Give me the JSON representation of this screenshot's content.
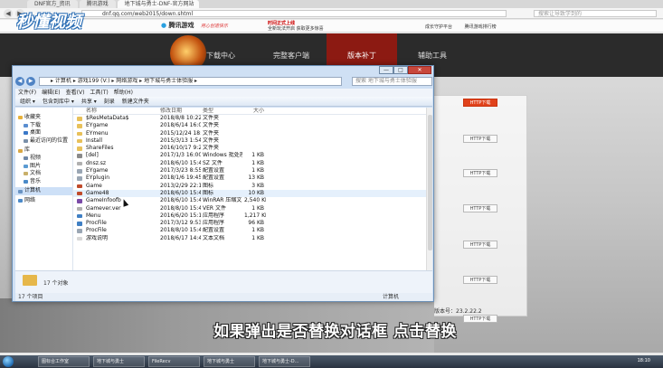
{
  "browser": {
    "tabs": [
      "DNF官方_资讯",
      "腾讯游戏",
      "地下城与勇士-DNF-官方网站",
      ""
    ],
    "address": "dnf.qq.com/web2015/down.shtml",
    "search_placeholder": "搜索让导致学到的",
    "nav_back": "◀",
    "nav_fwd": "▶"
  },
  "site": {
    "brand": "腾讯游戏",
    "slogan": "用心创造快乐",
    "promo_line1": "时间正式上线",
    "promo_line2": "全新玩法开启 获取更多惊喜",
    "top_links": [
      "成长守护平台",
      "腾讯游戏排行榜"
    ],
    "nav": [
      "下载中心",
      "完整客户端",
      "版本补丁",
      "辅助工具"
    ],
    "download_buttons": [
      "HTTP下载",
      "HTTP下载",
      "HTTP下载",
      "HTTP下载",
      "HTTP下载",
      "HTTP下载",
      "HTTP下载"
    ],
    "version_label": "版本号：23.2.22.2"
  },
  "explorer": {
    "nav_back": "◀",
    "nav_fwd": "▶",
    "minimize": "—",
    "maximize": "□",
    "close": "✕",
    "breadcrumb": "▸ 计算机 ▸ 游戏199 (V:) ▸ 网络游戏 ▸ 地下城与勇士体验服 ▸",
    "search_placeholder": "搜索 地下城与勇士体验服",
    "menu": [
      "文件(F)",
      "编辑(E)",
      "查看(V)",
      "工具(T)",
      "帮助(H)"
    ],
    "toolbar": [
      "组织 ▾",
      "包含到库中 ▾",
      "共享 ▾",
      "刻录",
      "新建文件夹"
    ],
    "nav_pane": [
      {
        "label": "收藏夹",
        "icon": "star-icon",
        "color": "#e8b23a",
        "group": true
      },
      {
        "label": "下载",
        "icon": "download-folder-icon",
        "color": "#5a8ed0"
      },
      {
        "label": "桌面",
        "icon": "desktop-icon",
        "color": "#3a78c8"
      },
      {
        "label": "最近访问的位置",
        "icon": "recent-icon",
        "color": "#7a8fa8"
      },
      {
        "label": "库",
        "icon": "library-icon",
        "color": "#d9a844",
        "group": true
      },
      {
        "label": "视频",
        "icon": "video-icon",
        "color": "#6f88a8"
      },
      {
        "label": "图片",
        "icon": "pictures-icon",
        "color": "#5b9bd2"
      },
      {
        "label": "文档",
        "icon": "documents-icon",
        "color": "#c9b06a"
      },
      {
        "label": "音乐",
        "icon": "music-icon",
        "color": "#4a8ac8"
      },
      {
        "label": "计算机",
        "icon": "computer-icon",
        "color": "#6a93c2",
        "group": true,
        "selected": true
      },
      {
        "label": "网络",
        "icon": "network-icon",
        "color": "#4b8ac9",
        "group": true
      }
    ],
    "columns": [
      "名称",
      "修改日期",
      "类型",
      "大小"
    ],
    "files": [
      {
        "name": "$ResMetaData$",
        "date": "2018/8/8 10:22",
        "type": "文件夹",
        "size": "",
        "color": "#e8c15a"
      },
      {
        "name": "EYgame",
        "date": "2018/6/14 16:00",
        "type": "文件夹",
        "size": "",
        "color": "#e8c15a"
      },
      {
        "name": "EYmenu",
        "date": "2015/12/24 18:00",
        "type": "文件夹",
        "size": "",
        "color": "#e8c15a"
      },
      {
        "name": "Install",
        "date": "2015/3/13 1:54",
        "type": "文件夹",
        "size": "",
        "color": "#e8c15a"
      },
      {
        "name": "ShareFiles",
        "date": "2016/10/17 9:23",
        "type": "文件夹",
        "size": "",
        "color": "#e8c15a"
      },
      {
        "name": "[del]",
        "date": "2017/1/3 16:00",
        "type": "Windows 批处理...",
        "size": "1 KB",
        "color": "#8a8a8a"
      },
      {
        "name": "dnsz.sz",
        "date": "2018/6/10 15:43",
        "type": "SZ 文件",
        "size": "1 KB",
        "color": "#b0b0b0"
      },
      {
        "name": "EYgame",
        "date": "2017/3/23 8:55",
        "type": "配置设置",
        "size": "1 KB",
        "color": "#9aa6b4"
      },
      {
        "name": "EYplugin",
        "date": "2018/1/6 19:45",
        "type": "配置设置",
        "size": "13 KB",
        "color": "#9aa6b4"
      },
      {
        "name": "Game",
        "date": "2013/2/29 22:19",
        "type": "图标",
        "size": "3 KB",
        "color": "#c04a2a"
      },
      {
        "name": "Game48",
        "date": "2018/6/10 15:41",
        "type": "图标",
        "size": "10 KB",
        "color": "#c04a2a"
      },
      {
        "name": "GameInfoofb",
        "date": "2018/6/10 15:43",
        "type": "WinRAR 压缩文...",
        "size": "2,540 KB",
        "color": "#7a4aa8"
      },
      {
        "name": "Gamever.ver",
        "date": "2018/8/10 15:43",
        "type": "VER 文件",
        "size": "1 KB",
        "color": "#b0b0b0"
      },
      {
        "name": "Menu",
        "date": "2016/6/20 15:15",
        "type": "应用程序",
        "size": "1,217 KB",
        "color": "#3f7fc4"
      },
      {
        "name": "ProcFile",
        "date": "2017/3/12 9:53",
        "type": "应用程序",
        "size": "96 KB",
        "color": "#3f7fc4"
      },
      {
        "name": "ProcFile",
        "date": "2018/8/10 15:43",
        "type": "配置设置",
        "size": "1 KB",
        "color": "#9aa6b4"
      },
      {
        "name": "游戏说明",
        "date": "2018/6/17 14:48",
        "type": "文本文档",
        "size": "1 KB",
        "color": "#d6d6d6"
      }
    ],
    "details": "17 个对象",
    "status_left": "17 个项目",
    "status_right": "计算机"
  },
  "taskbar": {
    "items": [
      "图标合工作室",
      "地下城与勇士",
      "FileRecv",
      "地下城与勇士",
      "地下城与勇士-D..."
    ],
    "clock": "18:10"
  },
  "overlay": {
    "caption": "如果弹出是否替换对话框 点击替换",
    "watermark": "秒懂视频"
  }
}
